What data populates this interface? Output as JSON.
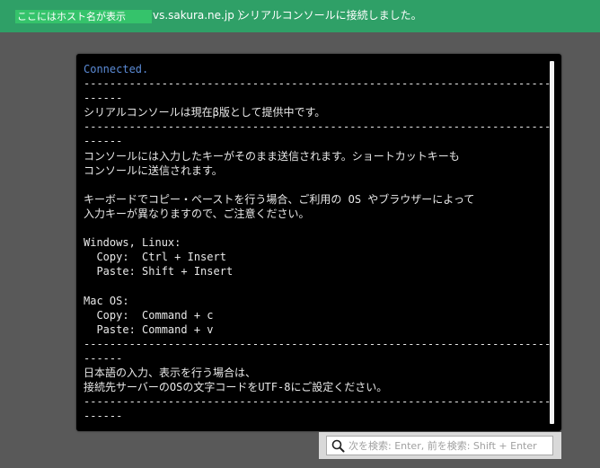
{
  "banner": {
    "host_placeholder": "ここにはホスト名が表示",
    "host_suffix": "vs.sakura.ne.jp ）",
    "message": "シリアルコンソールに接続しました。",
    "background_color": "#2fa067",
    "highlight_color": "#35c36b"
  },
  "terminal": {
    "status": "Connected.",
    "lines": [
      "------------------------------------------------------------------------",
      "------",
      "シリアルコンソールは現在β版として提供中です。",
      "------------------------------------------------------------------------",
      "------",
      "コンソールには入力したキーがそのまま送信されます。ショートカットキーも",
      "コンソールに送信されます。",
      "",
      "キーボードでコピー・ペーストを行う場合、ご利用の OS やブラウザーによって",
      "入力キーが異なりますので、ご注意ください。",
      "",
      "Windows, Linux:",
      "  Copy:  Ctrl + Insert",
      "  Paste: Shift + Insert",
      "",
      "Mac OS:",
      "  Copy:  Command + c",
      "  Paste: Command + v",
      "------------------------------------------------------------------------",
      "------",
      "日本語の入力、表示を行う場合は、",
      "接続先サーバーのOSの文字コードをUTF-8にご設定ください。",
      "------------------------------------------------------------------------",
      "------"
    ],
    "status_color": "#5b8bd6",
    "text_color": "#e8e8e8"
  },
  "search": {
    "icon": "search-icon",
    "placeholder": "次を検索: Enter, 前を検索: Shift + Enter",
    "value": ""
  }
}
